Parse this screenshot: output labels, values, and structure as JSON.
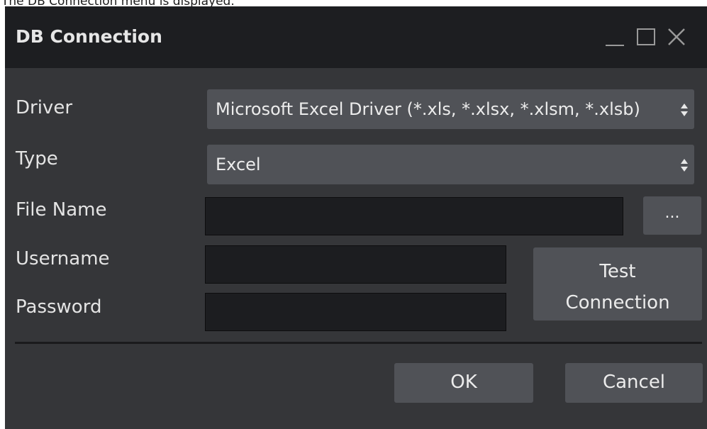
{
  "caption": "The DB Connection menu is displayed.",
  "window": {
    "title": "DB Connection",
    "controls": {
      "minimize": "minimize-icon",
      "maximize": "maximize-icon",
      "close": "close-icon"
    }
  },
  "form": {
    "driver": {
      "label": "Driver",
      "value": "Microsoft Excel Driver (*.xls, *.xlsx, *.xlsm, *.xlsb)"
    },
    "type": {
      "label": "Type",
      "value": "Excel"
    },
    "file_name": {
      "label": "File Name",
      "value": "",
      "browse_label": "..."
    },
    "username": {
      "label": "Username",
      "value": ""
    },
    "password": {
      "label": "Password",
      "value": ""
    },
    "test_connection": {
      "line1": "Test",
      "line2": "Connection"
    }
  },
  "footer": {
    "ok_label": "OK",
    "cancel_label": "Cancel"
  },
  "colors": {
    "titlebar": "#1d1e21",
    "body": "#353639",
    "control": "#505257",
    "input": "#1c1d20"
  }
}
